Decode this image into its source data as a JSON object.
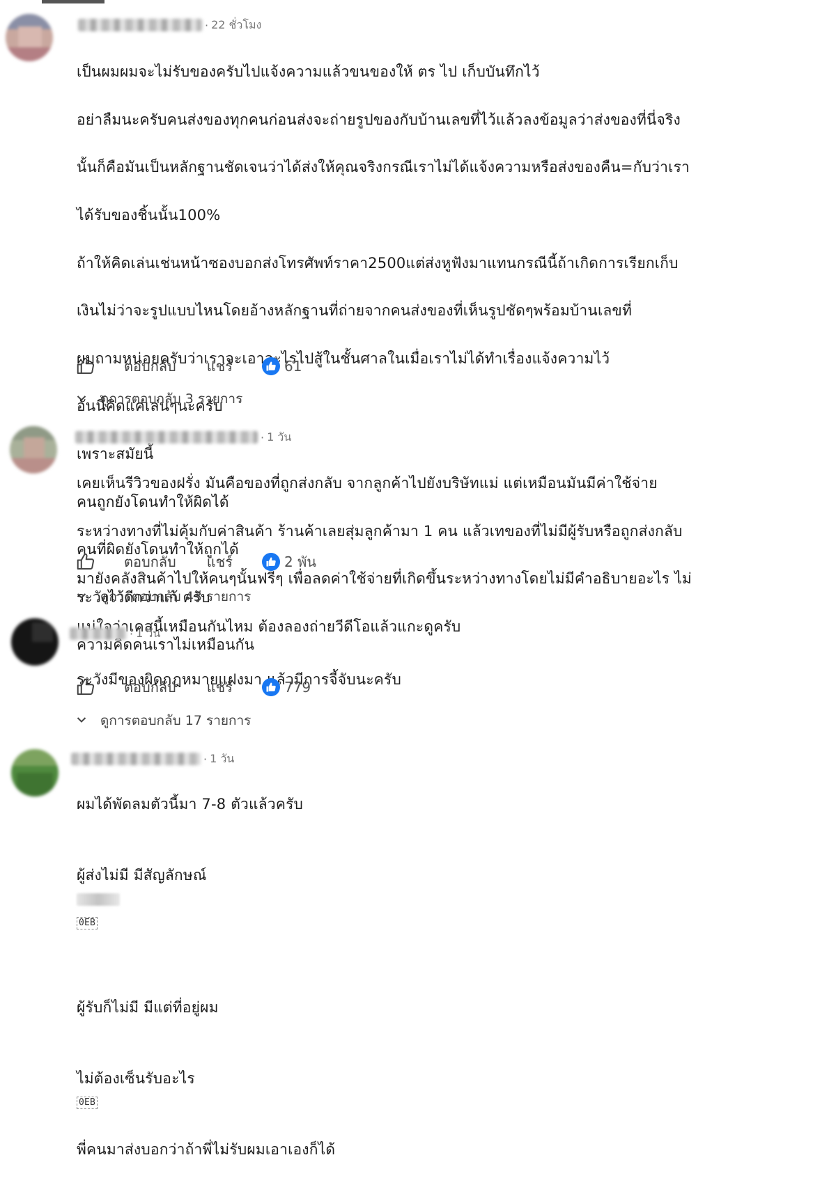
{
  "comments": [
    {
      "time": "22 ชั่วโมง",
      "lines": [
        "เป็นผมผมจะไม่รับของครับไปแจ้งความแล้วขนของให้ ตร ไป เก็บบันทึกไว้",
        "อย่าลืมนะครับคนส่งของทุกคนก่อนส่งจะถ่ายรูปของกับบ้านเลขที่ไว้แล้วลงข้อมูลว่าส่งของที่นี่จริง",
        "นั้นก็คือมันเป็นหลักฐานชัดเจนว่าได้ส่งให้คุณจริงกรณีเราไม่ได้แจ้งความหรือส่งของคืน=กับว่าเรา",
        "ได้รับของชิ้นนั้น100%",
        "ถ้าให้คิดเล่นเช่นหน้าซองบอกส่งโทรศัพท์ราคา2500แต่ส่งหูฟังมาแทนกรณีนี้ถ้าเกิดการเรียกเก็บ",
        "เงินไม่ว่าจะรูปแบบไหนโดยอ้างหลักฐานที่ถ่ายจากคนส่งของที่เห็นรูปชัดๆพร้อมบ้านเลขที่",
        "ผมถามหน่อยครับว่าเราจะเอาอะไรไปสู้ในชั้นศาลในเมื่อเราไม่ได้ทำเรื่องแจ้งความไว้",
        "อันนี้คิดแค่เล่นๆนะครับ",
        "เพราะสมัยนี้",
        "คนถูกยังโดนทำให้ผิดได้",
        "คนที่ผิดยังโดนทำให้ถูกได้",
        "ระวังไว้ดีกว่าแก้ ครับ",
        "ความคิดคนเราไม่เหมือนกัน"
      ],
      "reply_label": "ตอบกลับ",
      "share_label": "แชร์",
      "likes": "61",
      "view_replies": "ดูการตอบกลับ 3 รายการ"
    },
    {
      "time": "1 วัน",
      "lines": [
        "เคยเห็นรีวิวของฝรั่ง มันคือของที่ถูกส่งกลับ จากลูกค้าไปยังบริษัทแม่ แต่เหมือนมันมีค่าใช้จ่าย",
        "ระหว่างทางที่ไม่คุ้มกับค่าสินค้า ร้านค้าเลยสุ่มลูกค้ามา 1 คน แล้วเทของที่ไม่มีผู้รับหรือถูกส่งกลับ",
        "มายังคลังสินค้าไปให้คนๆนั้นฟรีๆ เพื่อลดค่าใช้จ่ายที่เกิดขึ้นระหว่างทางโดยไม่มีคำอธิบายอะไร ไม่",
        "แน่ใจว่าเคสนี้เหมือนกันไหม ต้องลองถ่ายวีดีโอแล้วแกะดูครับ"
      ],
      "reply_label": "ตอบกลับ",
      "share_label": "แชร์",
      "likes": "2 พัน",
      "view_replies": "ดูการตอบกลับ 43 รายการ"
    },
    {
      "time": "1 วัน",
      "lines": [
        "ระวังมีของผิดกฎหมายแฝงมา แล้วมีการจี้จับนะครับ"
      ],
      "reply_label": "ตอบกลับ",
      "share_label": "แชร์",
      "likes": "779",
      "view_replies": "ดูการตอบกลับ 17 รายการ"
    },
    {
      "time": "1 วัน",
      "line1": "ผมได้พัดลมตัวนี้มา 7-8 ตัวแล้วครับ",
      "line2": "ผู้ส่งไม่มี มีสัญลักษณ์",
      "line3": "ผู้รับก็ไม่มี มีแต่ที่อยู่ผม",
      "line4": "ไม่ต้องเซ็นรับอะไร",
      "line5": "พี่คนมาส่งบอกว่าถ้าพี่ไม่รับผมเอาเองก็ได้",
      "emoji_code": "0EB"
    }
  ],
  "colors": {
    "text": "#1c1c1c",
    "muted": "#777777",
    "like_blue": "#1877f2"
  },
  "icons": {
    "like": "thumbs-up-outline-icon",
    "liked": "thumbs-up-filled-icon",
    "expand": "chevron-down-icon"
  }
}
